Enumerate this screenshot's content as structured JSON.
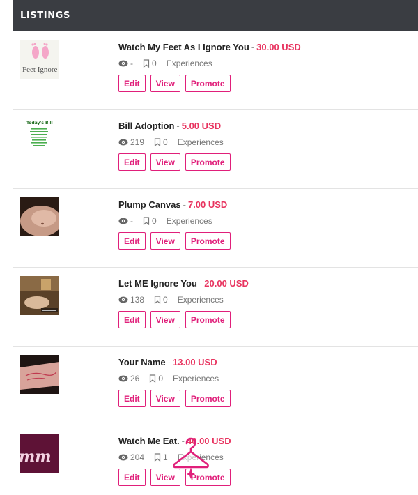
{
  "header": {
    "title": "LISTINGS"
  },
  "buttons": {
    "edit": "Edit",
    "view": "View",
    "promote": "Promote"
  },
  "listings": [
    {
      "title": "Watch My Feet As I Ignore You",
      "price": "30.00 USD",
      "views": "-",
      "saves": "0",
      "category": "Experiences",
      "thumb_text": "Feet Ignore"
    },
    {
      "title": "Bill Adoption",
      "price": "5.00 USD",
      "views": "219",
      "saves": "0",
      "category": "Experiences",
      "thumb_text": "Today's Bill"
    },
    {
      "title": "Plump Canvas",
      "price": "7.00 USD",
      "views": "-",
      "saves": "0",
      "category": "Experiences",
      "thumb_text": ""
    },
    {
      "title": "Let ME Ignore You",
      "price": "20.00 USD",
      "views": "138",
      "saves": "0",
      "category": "Experiences",
      "thumb_text": ""
    },
    {
      "title": "Your Name",
      "price": "13.00 USD",
      "views": "26",
      "saves": "0",
      "category": "Experiences",
      "thumb_text": ""
    },
    {
      "title": "Watch Me Eat.",
      "price": "40.00 USD",
      "views": "204",
      "saves": "1",
      "category": "Experiences",
      "thumb_text": "mm"
    }
  ],
  "colors": {
    "header_bg": "#3a3d42",
    "accent": "#e01f7a",
    "price": "#e8335f"
  }
}
